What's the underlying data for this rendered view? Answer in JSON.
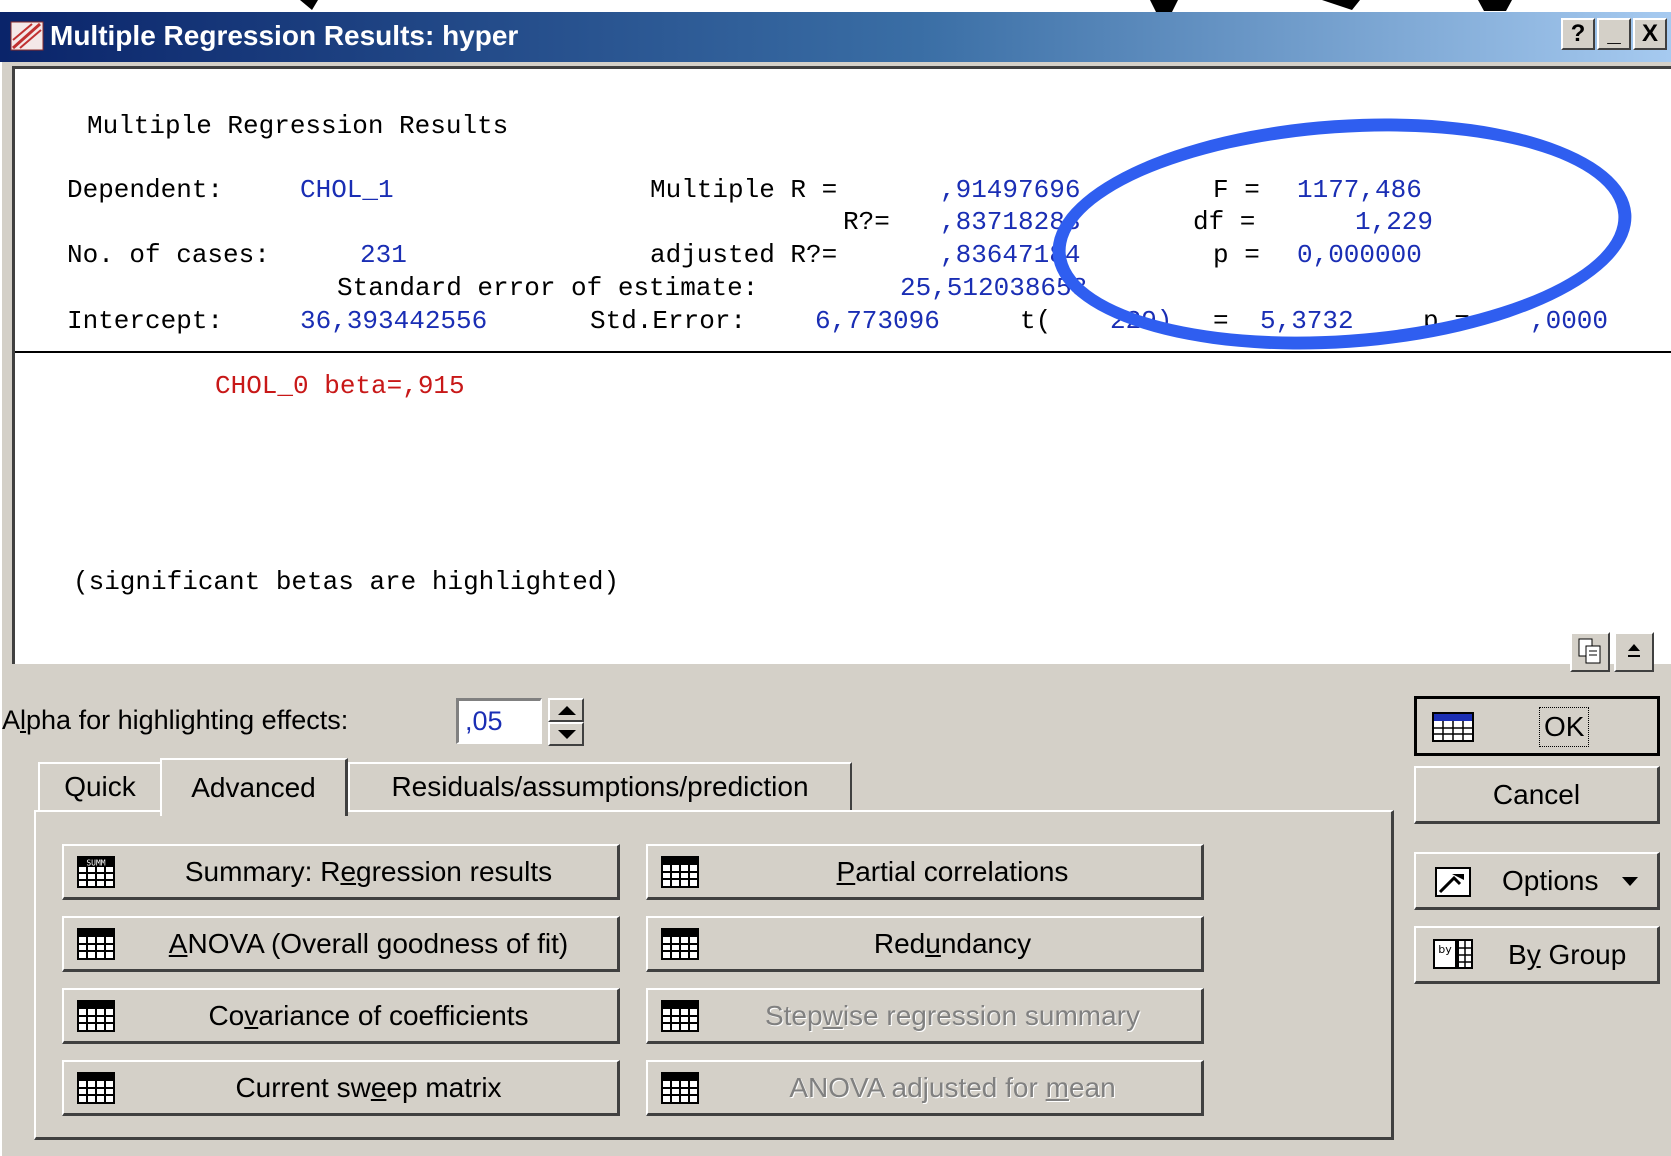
{
  "window": {
    "title": "Multiple Regression Results: hyper",
    "help_btn": "?",
    "min_btn": "_",
    "close_btn": "X"
  },
  "results": {
    "heading": "Multiple Regression Results",
    "dependent_label": "Dependent:",
    "dependent_value": "CHOL_1",
    "multiple_r_label": "Multiple R =",
    "multiple_r_value": ",91497696",
    "f_label": "F =",
    "f_value": "1177,486",
    "r2_label": "R?=",
    "r2_value": ",83718283",
    "df_label": "df =",
    "df_value": "1,229",
    "cases_label": "No. of cases:",
    "cases_value": "231",
    "adj_r2_label": "adjusted R?=",
    "adj_r2_value": ",83647184",
    "p_label": "p =",
    "p_value": "0,000000",
    "std_err_label": "Standard error of estimate:",
    "std_err_value": "25,512038658",
    "intercept_label": "Intercept:",
    "intercept_value": "36,393442556",
    "std_error_label": "Std.Error:",
    "std_error_value": "6,773096",
    "t_label": "t(",
    "t_df": "229)",
    "t_eq": "=",
    "t_value": "5,3732",
    "p2_label": "p =",
    "p2_value": ",0000",
    "beta_line": "CHOL_0 beta=,915",
    "footnote": "(significant betas are highlighted)"
  },
  "alpha": {
    "label_pre": "A",
    "label_u": "l",
    "label_post": "pha for highlighting effects:",
    "value": ",05"
  },
  "tabs": [
    {
      "label": "Quick"
    },
    {
      "label": "Advanced"
    },
    {
      "label": "Residuals/assumptions/prediction"
    }
  ],
  "buttons": {
    "summary": {
      "pre": "Summary:  R",
      "u": "e",
      "post": "gression results"
    },
    "anova": {
      "pre": "",
      "u": "A",
      "post": "NOVA (Overall goodness of fit)"
    },
    "covariance": {
      "pre": "Co",
      "u": "v",
      "post": "ariance of coefficients"
    },
    "sweep": {
      "pre": "Current sw",
      "u": "e",
      "post": "ep matrix"
    },
    "partial": {
      "pre": "",
      "u": "P",
      "post": "artial correlations"
    },
    "redundancy": {
      "pre": "Red",
      "u": "u",
      "post": "ndancy"
    },
    "stepwise": {
      "pre": "Step",
      "u": "w",
      "post": "ise regression summary"
    },
    "anova_mean": {
      "pre": "ANOVA adjusted for ",
      "u": "m",
      "post": "ean"
    }
  },
  "side": {
    "ok": "OK",
    "cancel": "Cancel",
    "options": "Options",
    "bygroup_pre": "B",
    "bygroup_u": "y",
    "bygroup_post": " Group"
  },
  "colors": {
    "accent_blue": "#1a2eb4",
    "highlight_red": "#c81818",
    "annotation_circle": "#2f5ef0"
  }
}
